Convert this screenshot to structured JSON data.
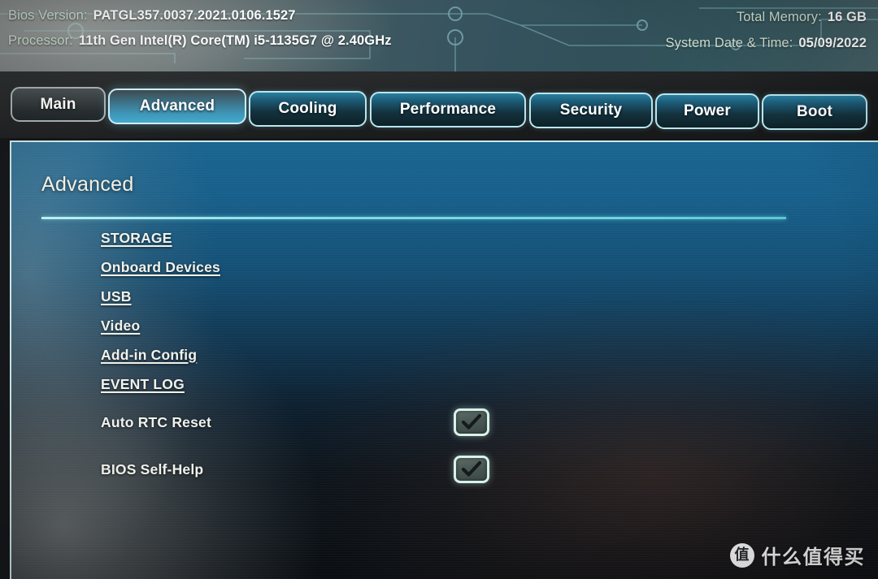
{
  "header": {
    "bios_version_label": "Bios Version:",
    "bios_version_value": "PATGL357.0037.2021.0106.1527",
    "processor_label": "Processor:",
    "processor_value": "11th Gen Intel(R) Core(TM) i5-1135G7 @ 2.40GHz",
    "total_memory_label": "Total Memory:",
    "total_memory_value": "16 GB",
    "system_datetime_label": "System Date & Time:",
    "system_datetime_value": "05/09/2022"
  },
  "tabs": [
    {
      "label": "Main",
      "active": false,
      "style": "dim"
    },
    {
      "label": "Advanced",
      "active": true,
      "style": "active"
    },
    {
      "label": "Cooling",
      "active": false,
      "style": "normal"
    },
    {
      "label": "Performance",
      "active": false,
      "style": "normal"
    },
    {
      "label": "Security",
      "active": false,
      "style": "normal"
    },
    {
      "label": "Power",
      "active": false,
      "style": "normal"
    },
    {
      "label": "Boot",
      "active": false,
      "style": "normal"
    }
  ],
  "page": {
    "title": "Advanced",
    "menu_links": [
      "STORAGE",
      "Onboard Devices",
      "USB",
      "Video",
      "Add-in Config",
      "EVENT LOG"
    ],
    "options": [
      {
        "label": "Auto RTC Reset",
        "checked": true
      },
      {
        "label": "BIOS Self-Help",
        "checked": true
      }
    ]
  },
  "watermark": {
    "logo_glyph": "值",
    "text": "什么值得买"
  },
  "colors": {
    "accent_cyan": "#7fdde2",
    "tab_border": "#b9e6ef",
    "active_tab": "#45a9cc",
    "label_green": "#cfe0d2",
    "value_white": "#ffffff",
    "panel_blue": "#1a6896"
  }
}
